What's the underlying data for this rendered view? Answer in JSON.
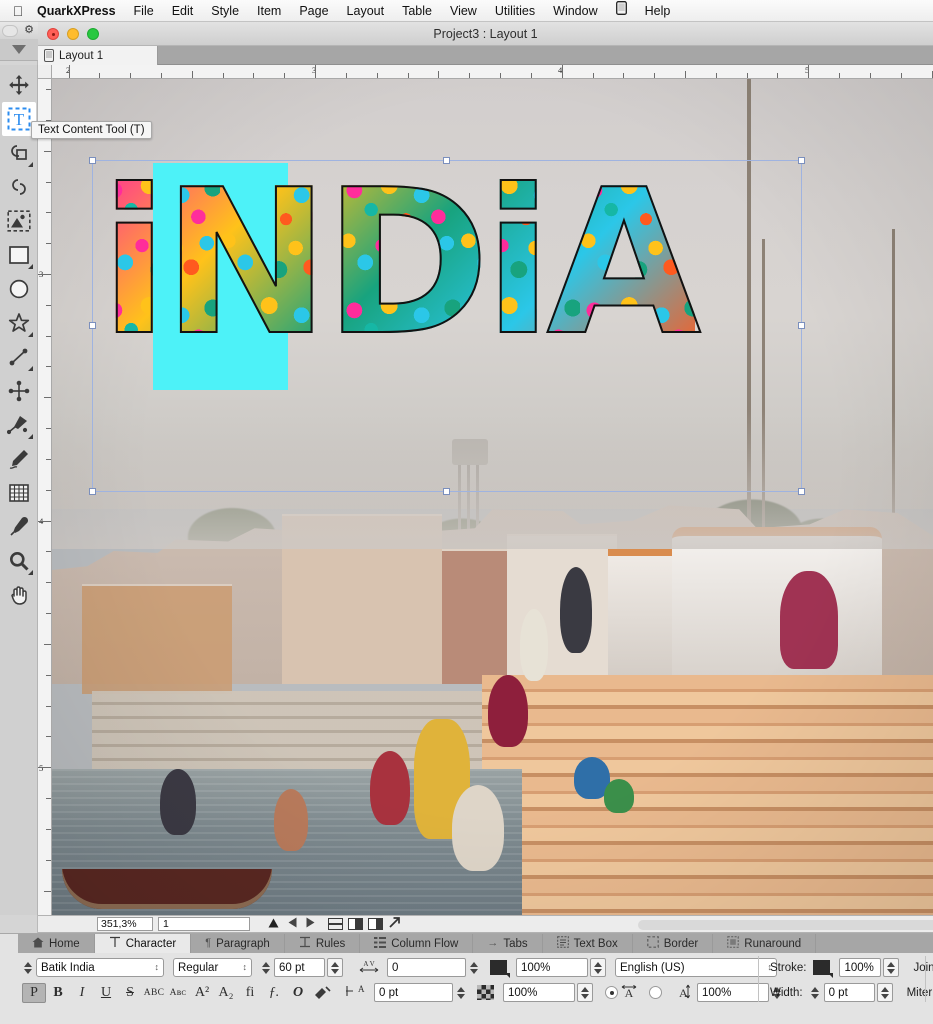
{
  "menubar": {
    "apple": "apple-logo",
    "items": [
      {
        "label": "QuarkXPress",
        "bold": true
      },
      {
        "label": "File"
      },
      {
        "label": "Edit"
      },
      {
        "label": "Style"
      },
      {
        "label": "Item"
      },
      {
        "label": "Page"
      },
      {
        "label": "Layout"
      },
      {
        "label": "Table"
      },
      {
        "label": "View"
      },
      {
        "label": "Utilities"
      },
      {
        "label": "Window"
      },
      {
        "label": "Help"
      }
    ]
  },
  "window": {
    "title": "Project3 : Layout 1"
  },
  "layout_tabs": [
    {
      "label": "Layout 1"
    }
  ],
  "tooltip": {
    "text": "Text Content Tool (T)"
  },
  "toolbox": [
    {
      "name": "item-tool",
      "icon": "move-arrows-icon",
      "active": false,
      "submenu": false
    },
    {
      "name": "text-content-tool",
      "icon": "text-T-icon",
      "active": true,
      "submenu": false
    },
    {
      "name": "link-text-box-tool",
      "icon": "link-chain-icon",
      "active": false,
      "submenu": true
    },
    {
      "name": "unlink-text-box-tool",
      "icon": "unlink-chain-icon",
      "active": false,
      "submenu": false
    },
    {
      "name": "picture-content-tool",
      "icon": "picture-frame-icon",
      "active": false,
      "submenu": false
    },
    {
      "name": "rectangle-box-tool",
      "icon": "rectangle-icon",
      "active": false,
      "submenu": true
    },
    {
      "name": "oval-box-tool",
      "icon": "circle-icon",
      "active": false,
      "submenu": false
    },
    {
      "name": "starburst-tool",
      "icon": "star-icon",
      "active": false,
      "submenu": true
    },
    {
      "name": "line-tool",
      "icon": "line-segment-icon",
      "active": false,
      "submenu": true
    },
    {
      "name": "bezier-node-tool",
      "icon": "node-cross-icon",
      "active": false,
      "submenu": false
    },
    {
      "name": "bezier-pen-tool",
      "icon": "pen-nib-icon",
      "active": false,
      "submenu": true
    },
    {
      "name": "freehand-tool",
      "icon": "pencil-icon",
      "active": false,
      "submenu": false
    },
    {
      "name": "tables-tool",
      "icon": "table-grid-icon",
      "active": false,
      "submenu": false
    },
    {
      "name": "eyedropper-tool",
      "icon": "eyedropper-icon",
      "active": false,
      "submenu": false
    },
    {
      "name": "zoom-tool",
      "icon": "magnifier-icon",
      "active": false,
      "submenu": true
    },
    {
      "name": "pan-tool",
      "icon": "hand-icon",
      "active": false,
      "submenu": false
    }
  ],
  "rulers": {
    "unit": "inches",
    "horizontal_labels": [
      "2",
      "3",
      "4",
      "5"
    ],
    "vertical_labels": [
      "3",
      "4",
      "5"
    ]
  },
  "document": {
    "text_content": "iNDiA",
    "selection_color": "#4df2f8",
    "frame_color": "#9fb3e0"
  },
  "statusbar": {
    "zoom": "351,3%",
    "page": "1",
    "nav_icons": [
      "triangle-up-icon",
      "triangle-left-icon",
      "triangle-right-icon"
    ],
    "view_icons": [
      "split-horizontal-icon",
      "single-page-icon",
      "facing-pages-icon",
      "expand-arrow-icon"
    ]
  },
  "palette": {
    "tabs": [
      {
        "label": "Home",
        "icon": "home-icon",
        "active": false
      },
      {
        "label": "Character",
        "icon": "character-T-icon",
        "active": true
      },
      {
        "label": "Paragraph",
        "icon": "pilcrow-icon",
        "active": false
      },
      {
        "label": "Rules",
        "icon": "rules-icon",
        "active": false
      },
      {
        "label": "Column Flow",
        "icon": "columns-icon",
        "active": false
      },
      {
        "label": "Tabs",
        "icon": "tab-arrow-icon",
        "active": false
      },
      {
        "label": "Text Box",
        "icon": "text-box-icon",
        "active": false
      },
      {
        "label": "Border",
        "icon": "border-icon",
        "active": false
      },
      {
        "label": "Runaround",
        "icon": "runaround-icon",
        "active": false
      }
    ],
    "character": {
      "font_family": "Batik India",
      "font_style": "Regular",
      "font_size": "60 pt",
      "tracking_icon": "kerning-tracking-icon",
      "tracking": "0",
      "baseline_icon": "baseline-shift-icon",
      "baseline_shift": "0 pt",
      "color_swatch": "#2b2b2b",
      "color_opacity": "100%",
      "shade_icon": "shade-checker-icon",
      "shade": "100%",
      "language": "English (US)",
      "scale_mode_icon": "horizontal-scale-icon",
      "scale_alt_icon": "vertical-scale-icon",
      "scale_value_icon": "scale-value-icon",
      "scale_value": "100%",
      "style_buttons": [
        {
          "label": "P",
          "name": "plain-style-button",
          "active": true
        },
        {
          "label": "B",
          "name": "bold-style-button",
          "active": false
        },
        {
          "label": "I",
          "name": "italic-style-button",
          "active": false
        },
        {
          "label": "U",
          "name": "underline-style-button",
          "active": false
        },
        {
          "label": "S",
          "name": "strikethrough-style-button",
          "active": false
        },
        {
          "label": "ABC",
          "name": "all-caps-style-button",
          "active": false
        },
        {
          "label": "Aʙᴄ",
          "name": "small-caps-style-button",
          "active": false
        },
        {
          "label": "A²",
          "name": "superscript-style-button",
          "active": false
        },
        {
          "label": "A₂",
          "name": "subscript-style-button",
          "active": false
        },
        {
          "label": "fi",
          "name": "ligature-style-button",
          "active": false
        },
        {
          "label": "ƒ.",
          "name": "opentype-style-button",
          "active": false
        },
        {
          "label": "O",
          "name": "outline-style-button",
          "active": false
        },
        {
          "label": "◤",
          "name": "shadow-style-button",
          "active": false
        }
      ],
      "stroke_label": "Stroke:",
      "stroke_value": "100%",
      "width_label": "Width:",
      "width_value": "0 pt",
      "join_label": "Join:",
      "miter_label": "Miter"
    }
  }
}
